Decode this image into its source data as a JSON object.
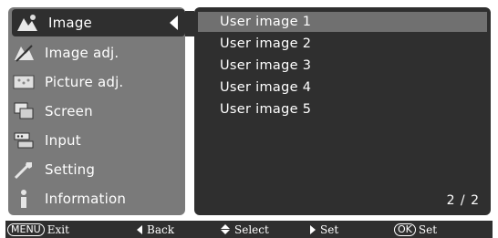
{
  "menu": {
    "items": [
      {
        "label": "Image",
        "icon": "image-icon"
      },
      {
        "label": "Image adj.",
        "icon": "image-adj-icon"
      },
      {
        "label": "Picture adj.",
        "icon": "picture-adj-icon"
      },
      {
        "label": "Screen",
        "icon": "screen-icon"
      },
      {
        "label": "Input",
        "icon": "input-icon"
      },
      {
        "label": "Setting",
        "icon": "setting-icon"
      },
      {
        "label": "Information",
        "icon": "information-icon"
      }
    ]
  },
  "panel": {
    "options": [
      "User image 1",
      "User image 2",
      "User image 3",
      "User image 4",
      "User image 5"
    ],
    "page": "2 / 2"
  },
  "statusbar": {
    "menu_key": "MENU",
    "exit": "Exit",
    "back": "Back",
    "select": "Select",
    "set": "Set",
    "ok_key": "OK",
    "ok_set": "Set"
  },
  "colors": {
    "sidebar": "#7a7a7a",
    "panel": "#2f2f2f",
    "highlight": "#707070"
  }
}
